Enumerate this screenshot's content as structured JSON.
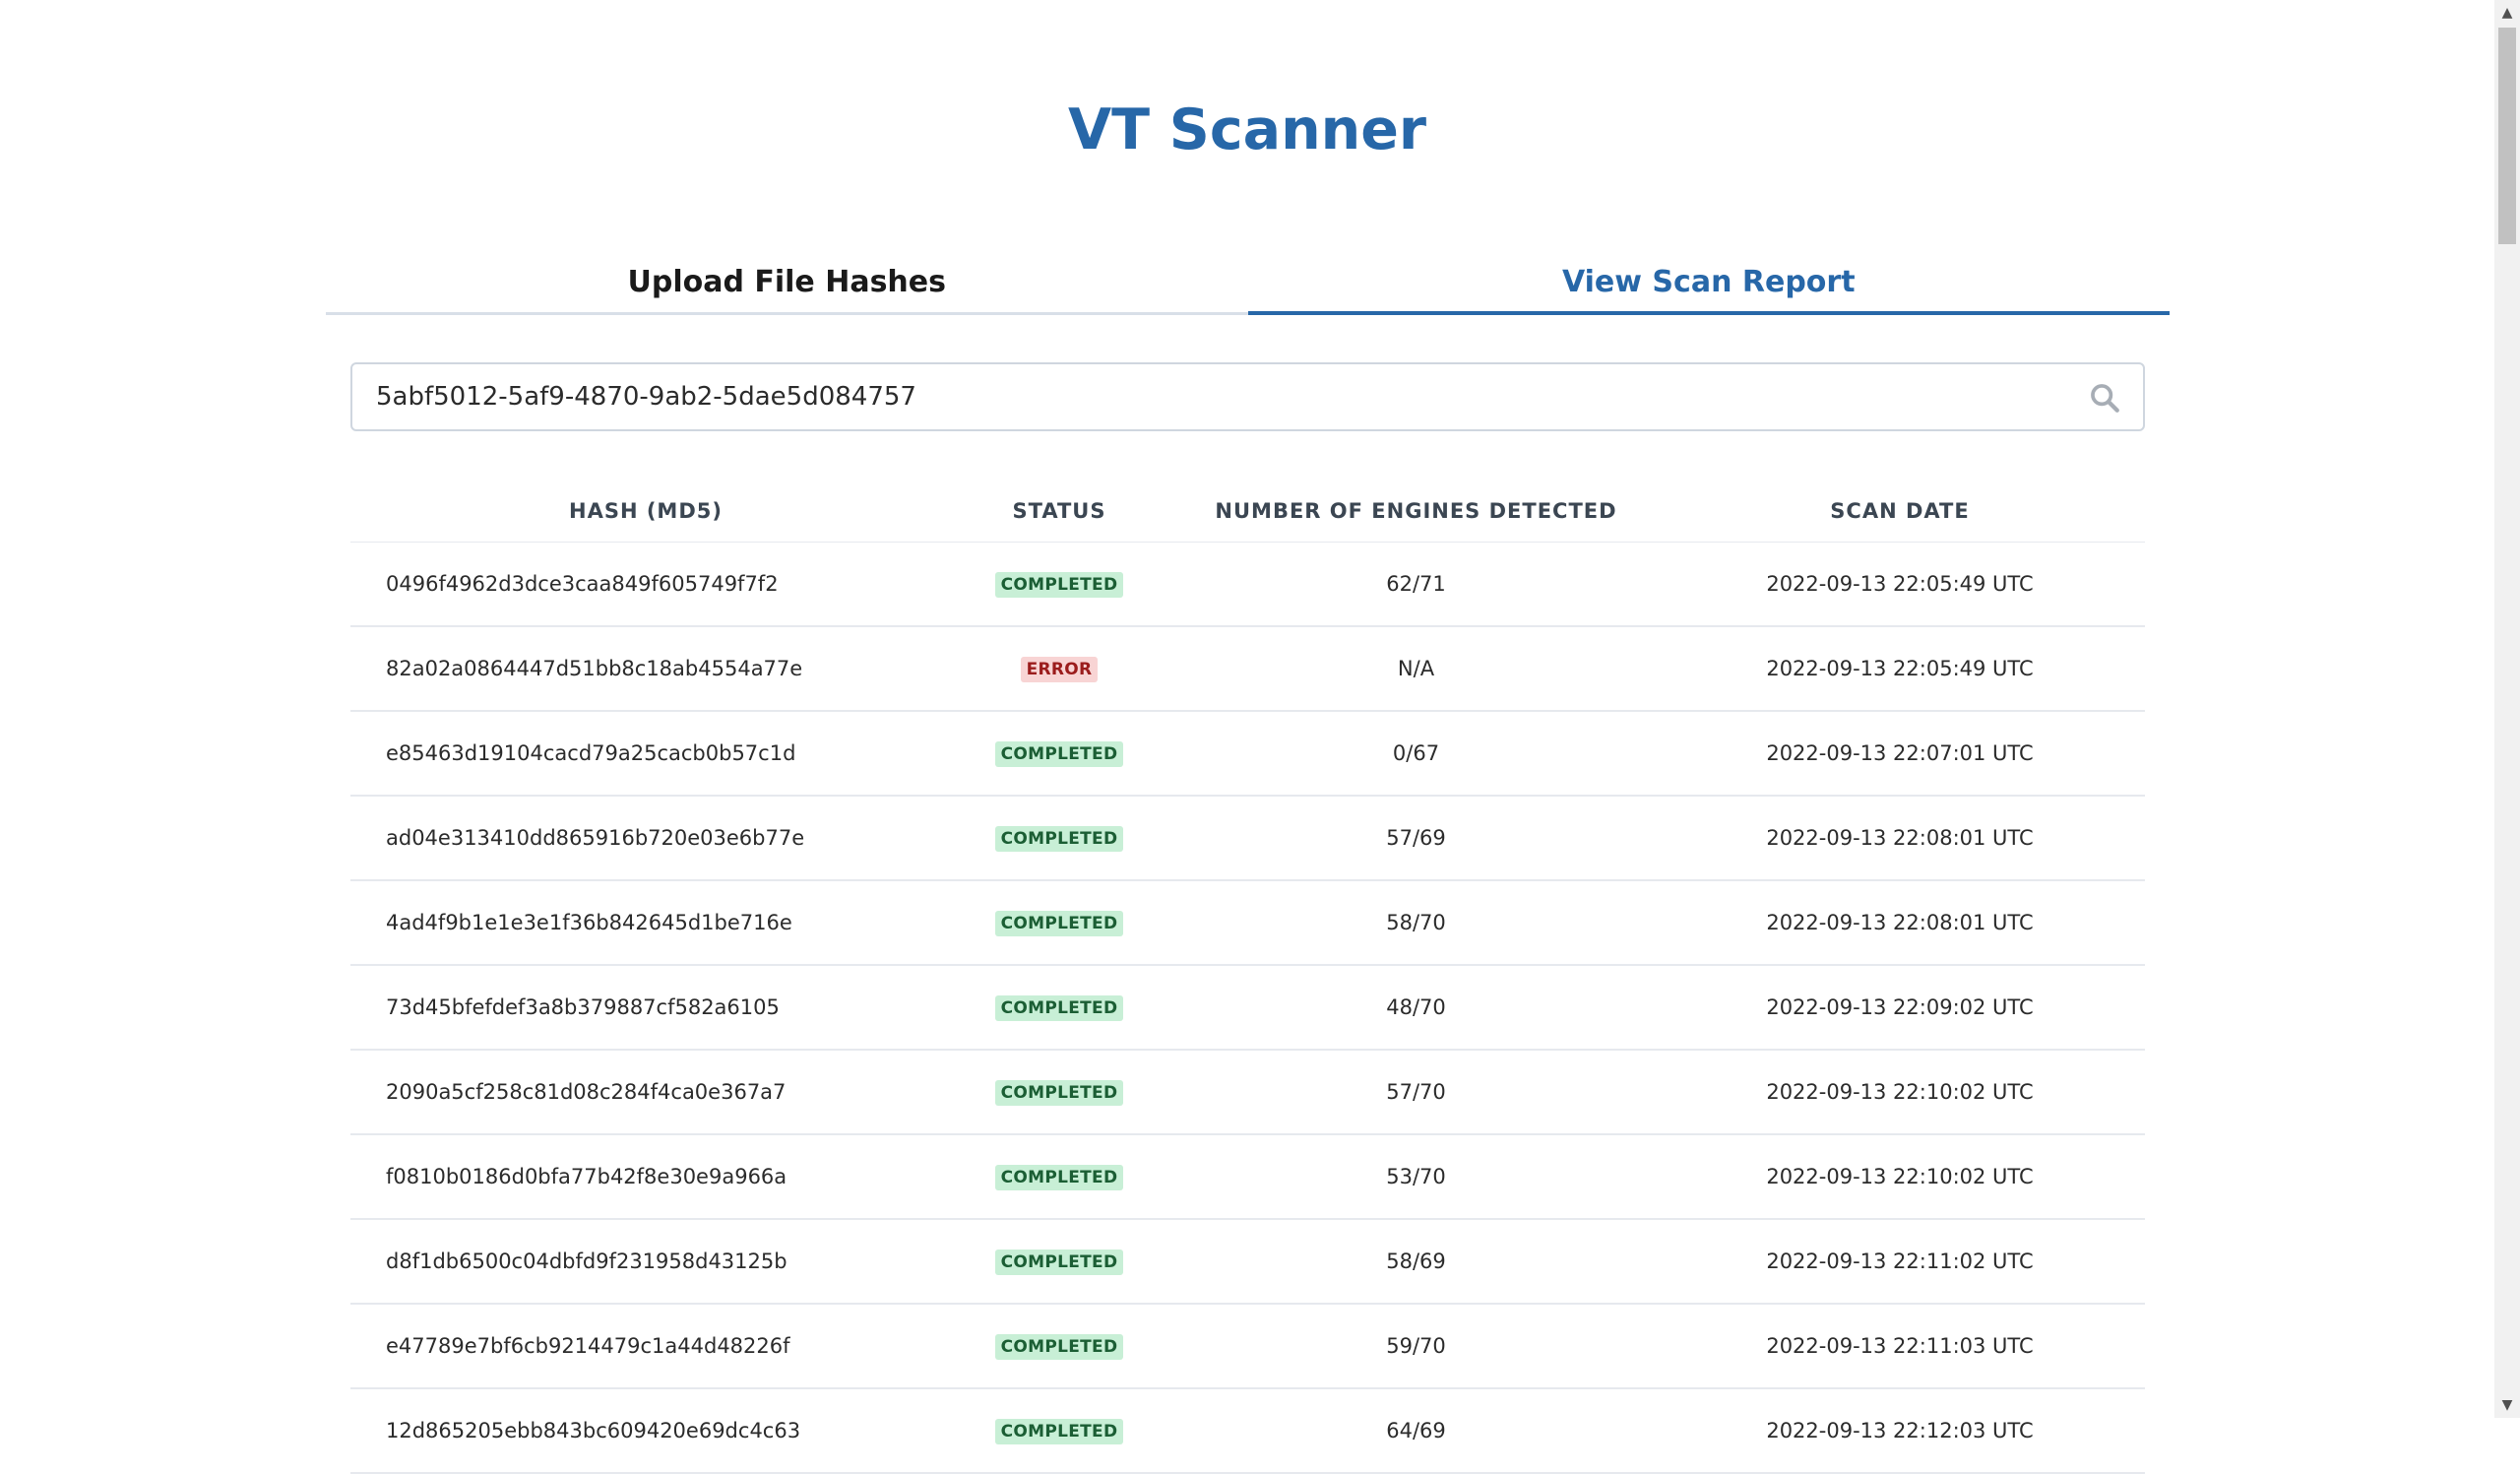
{
  "app": {
    "title": "VT Scanner"
  },
  "tabs": [
    {
      "label": "Upload File Hashes",
      "active": false
    },
    {
      "label": "View Scan Report",
      "active": true
    }
  ],
  "search": {
    "value": "5abf5012-5af9-4870-9ab2-5dae5d084757",
    "icon": "search-icon"
  },
  "table": {
    "headers": [
      "HASH (MD5)",
      "STATUS",
      "NUMBER OF ENGINES DETECTED",
      "SCAN DATE"
    ],
    "rows": [
      {
        "hash": "0496f4962d3dce3caa849f605749f7f2",
        "status": "COMPLETED",
        "engines": "62/71",
        "date": "2022-09-13 22:05:49 UTC"
      },
      {
        "hash": "82a02a0864447d51bb8c18ab4554a77e",
        "status": "ERROR",
        "engines": "N/A",
        "date": "2022-09-13 22:05:49 UTC"
      },
      {
        "hash": "e85463d19104cacd79a25cacb0b57c1d",
        "status": "COMPLETED",
        "engines": "0/67",
        "date": "2022-09-13 22:07:01 UTC"
      },
      {
        "hash": "ad04e313410dd865916b720e03e6b77e",
        "status": "COMPLETED",
        "engines": "57/69",
        "date": "2022-09-13 22:08:01 UTC"
      },
      {
        "hash": "4ad4f9b1e1e3e1f36b842645d1be716e",
        "status": "COMPLETED",
        "engines": "58/70",
        "date": "2022-09-13 22:08:01 UTC"
      },
      {
        "hash": "73d45bfefdef3a8b379887cf582a6105",
        "status": "COMPLETED",
        "engines": "48/70",
        "date": "2022-09-13 22:09:02 UTC"
      },
      {
        "hash": "2090a5cf258c81d08c284f4ca0e367a7",
        "status": "COMPLETED",
        "engines": "57/70",
        "date": "2022-09-13 22:10:02 UTC"
      },
      {
        "hash": "f0810b0186d0bfa77b42f8e30e9a966a",
        "status": "COMPLETED",
        "engines": "53/70",
        "date": "2022-09-13 22:10:02 UTC"
      },
      {
        "hash": "d8f1db6500c04dbfd9f231958d43125b",
        "status": "COMPLETED",
        "engines": "58/69",
        "date": "2022-09-13 22:11:02 UTC"
      },
      {
        "hash": "e47789e7bf6cb9214479c1a44d48226f",
        "status": "COMPLETED",
        "engines": "59/70",
        "date": "2022-09-13 22:11:03 UTC"
      },
      {
        "hash": "12d865205ebb843bc609420e69dc4c63",
        "status": "COMPLETED",
        "engines": "64/69",
        "date": "2022-09-13 22:12:03 UTC"
      }
    ]
  },
  "colors": {
    "accent": "#2767a8",
    "completed_bg": "#c8efd6",
    "completed_text": "#1b5e34",
    "error_bg": "#f8d4d4",
    "error_text": "#9b1c1c"
  }
}
